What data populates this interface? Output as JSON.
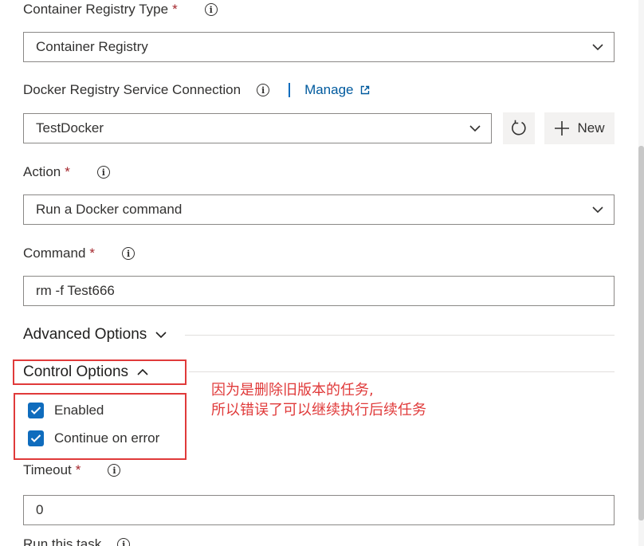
{
  "container_registry_type": {
    "label": "Container Registry Type",
    "required_mark": "*",
    "value": "Container Registry"
  },
  "docker_connection": {
    "label": "Docker Registry Service Connection",
    "manage_label": "Manage",
    "value": "TestDocker",
    "new_label": "New"
  },
  "action": {
    "label": "Action",
    "required_mark": "*",
    "value": "Run a Docker command"
  },
  "command": {
    "label": "Command",
    "required_mark": "*",
    "value": "rm -f Test666"
  },
  "advanced_options": {
    "label": "Advanced Options"
  },
  "control_options": {
    "label": "Control Options",
    "enabled_label": "Enabled",
    "enabled_checked": true,
    "continue_on_error_label": "Continue on error",
    "continue_on_error_checked": true
  },
  "annotation": {
    "line1": "因为是删除旧版本的任务,",
    "line2": "所以错误了可以继续执行后续任务"
  },
  "timeout": {
    "label": "Timeout",
    "required_mark": "*",
    "value": "0"
  },
  "run_this_task": {
    "label": "Run this task"
  },
  "colors": {
    "accent": "#0f6cbd",
    "annotation_red": "#e03a3a",
    "required_red": "#a4262c"
  }
}
